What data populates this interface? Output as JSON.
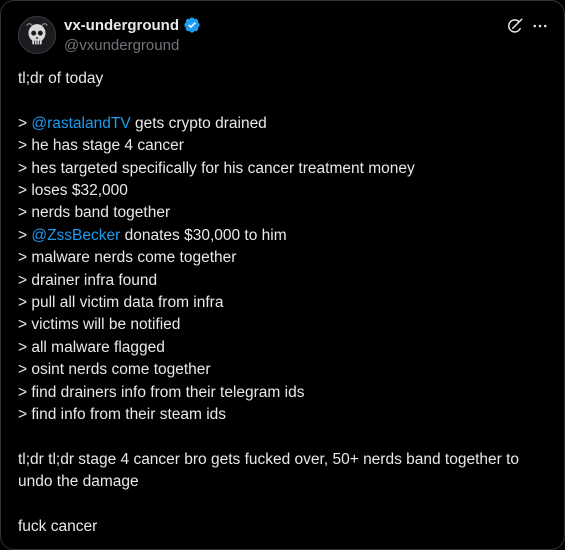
{
  "author": {
    "display_name": "vx-underground",
    "handle": "@vxunderground",
    "verified_color": "#1d9bf0"
  },
  "icons": {
    "verified": "verified-badge-icon",
    "grok": "grok-icon",
    "more": "more-options-icon"
  },
  "tweet": {
    "intro": "tl;dr of today",
    "lines": [
      {
        "mention": "@rastalandTV",
        "text": " gets crypto drained"
      },
      {
        "text": "he has stage 4 cancer"
      },
      {
        "text": "hes targeted specifically for his cancer treatment money"
      },
      {
        "text": "loses $32,000"
      },
      {
        "text": "nerds band together"
      },
      {
        "mention": "@ZssBecker",
        "text": " donates $30,000 to him"
      },
      {
        "text": "malware nerds come together"
      },
      {
        "text": "drainer infra found"
      },
      {
        "text": "pull all victim data from infra"
      },
      {
        "text": "victims will be notified"
      },
      {
        "text": "all malware flagged"
      },
      {
        "text": "osint nerds come together"
      },
      {
        "text": "find drainers info from their telegram ids"
      },
      {
        "text": "find info from their steam ids"
      }
    ],
    "prefix": "> ",
    "summary": "tl;dr tl;dr stage 4 cancer bro gets fucked over, 50+ nerds band together to undo the damage",
    "closing": "fuck cancer"
  },
  "colors": {
    "background": "#000000",
    "text": "#e7e9ea",
    "secondary": "#71767b",
    "link": "#1d9bf0",
    "border": "#2f3336"
  }
}
